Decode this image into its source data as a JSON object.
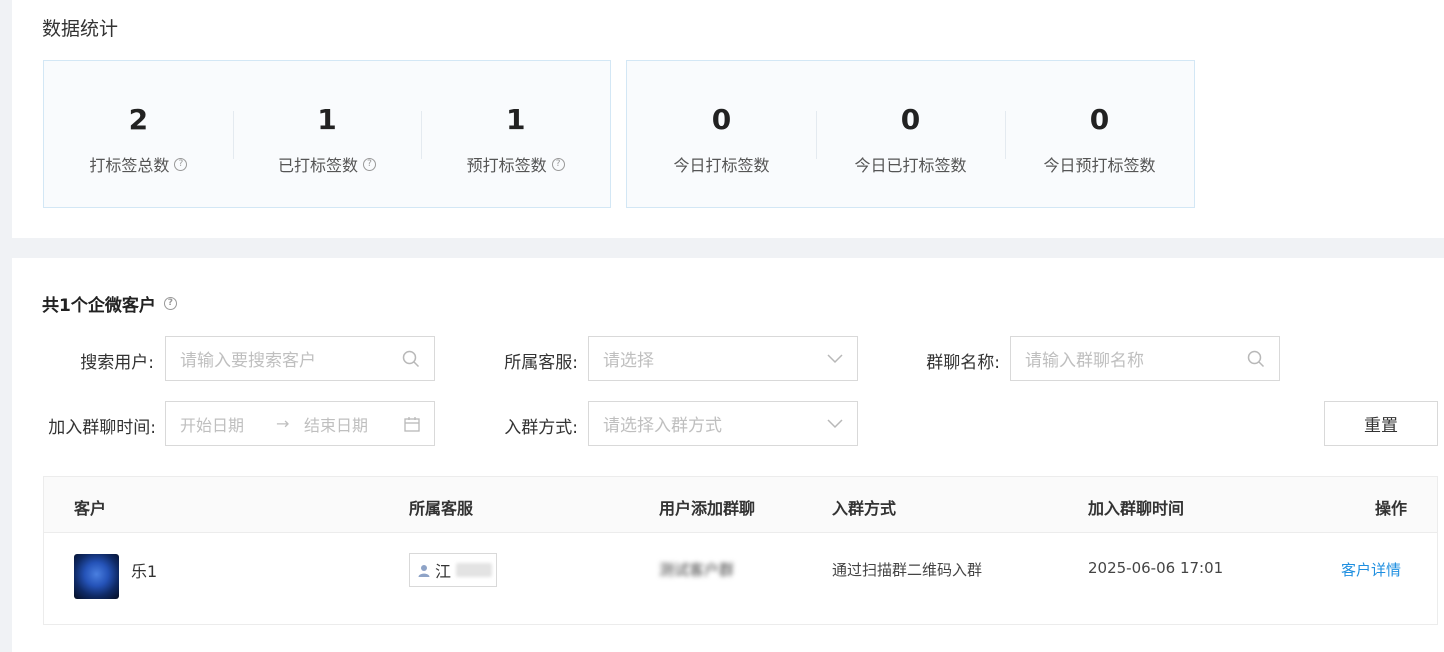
{
  "stats_section": {
    "title": "数据统计",
    "group1": [
      {
        "value": "2",
        "label": "打标签总数",
        "help": "?"
      },
      {
        "value": "1",
        "label": "已打标签数",
        "help": "?"
      },
      {
        "value": "1",
        "label": "预打标签数",
        "help": "?"
      }
    ],
    "group2": [
      {
        "value": "0",
        "label": "今日打标签数"
      },
      {
        "value": "0",
        "label": "今日已打标签数"
      },
      {
        "value": "0",
        "label": "今日预打标签数"
      }
    ]
  },
  "customers": {
    "count_title": "共1个企微客户",
    "filters": {
      "search_user_label": "搜索用户:",
      "search_user_placeholder": "请输入要搜索客户",
      "agent_label": "所属客服:",
      "agent_placeholder": "请选择",
      "group_name_label": "群聊名称:",
      "group_name_placeholder": "请输入群聊名称",
      "join_time_label": "加入群聊时间:",
      "start_date_placeholder": "开始日期",
      "end_date_placeholder": "结束日期",
      "join_method_label": "入群方式:",
      "join_method_placeholder": "请选择入群方式",
      "reset_label": "重置"
    },
    "table": {
      "columns": [
        "客户",
        "所属客服",
        "用户添加群聊",
        "入群方式",
        "加入群聊时间",
        "操作"
      ],
      "rows": [
        {
          "customer": "乐1",
          "agent": "江",
          "group": "测试客户群",
          "join_method": "通过扫描群二维码入群",
          "join_time": "2025-06-06 17:01",
          "action": "客户详情"
        }
      ]
    }
  },
  "icons": {
    "help": "question-circle-icon",
    "search": "search-icon",
    "dropdown": "chevron-down-icon",
    "calendar": "calendar-icon",
    "user": "user-icon"
  },
  "colors": {
    "link": "#1f8fe0",
    "stat_box_border": "#d3e7f5",
    "stat_box_bg": "#f9fbfd"
  }
}
